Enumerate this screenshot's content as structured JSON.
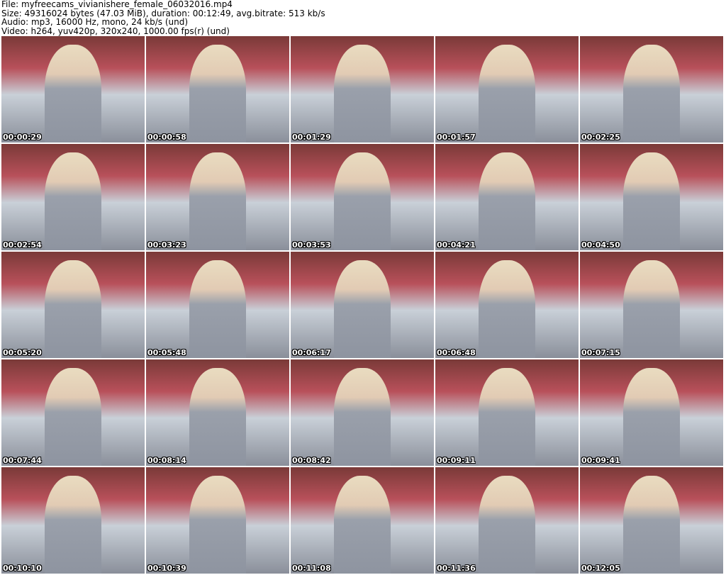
{
  "header": {
    "file": "File: myfreecams_vivianishere_female_06032016.mp4",
    "size": "Size: 49316024 bytes (47.03 MiB), duration: 00:12:49, avg.bitrate: 513 kb/s",
    "audio": "Audio: mp3, 16000 Hz, mono, 24 kb/s (und)",
    "video": "Video: h264, yuv420p, 320x240, 1000.00 fps(r) (und)"
  },
  "thumbnails": [
    "00:00:29",
    "00:00:58",
    "00:01:29",
    "00:01:57",
    "00:02:25",
    "00:02:54",
    "00:03:23",
    "00:03:53",
    "00:04:21",
    "00:04:50",
    "00:05:20",
    "00:05:48",
    "00:06:17",
    "00:06:48",
    "00:07:15",
    "00:07:44",
    "00:08:14",
    "00:08:42",
    "00:09:11",
    "00:09:41",
    "00:10:10",
    "00:10:39",
    "00:11:08",
    "00:11:36",
    "00:12:05"
  ]
}
